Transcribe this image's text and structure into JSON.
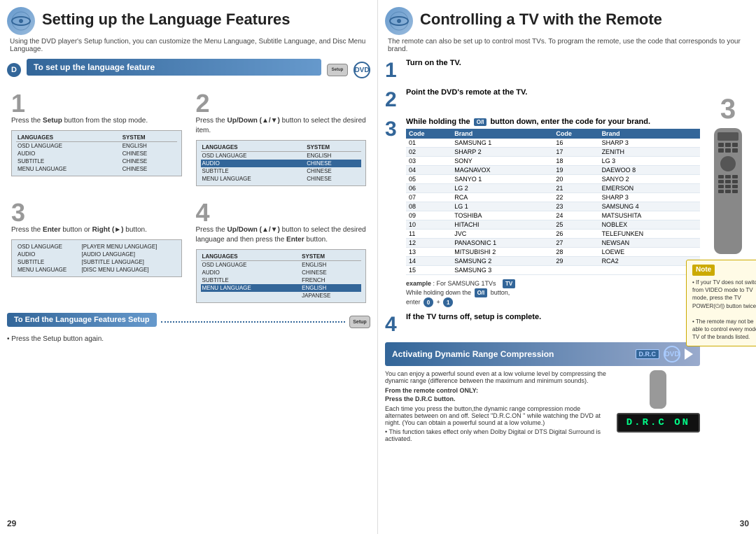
{
  "left": {
    "title": "Setting up the Language Features",
    "subtitle": "Using the DVD player's Setup function, you can customize the Menu Language, Subtitle Language, and Disc Menu Language.",
    "section_bar": "To set up the language feature",
    "dvd_label": "DVD",
    "steps": [
      {
        "num": "1",
        "text": "Press the <b>Setup</b> button from the stop mode.",
        "screen": "languages"
      },
      {
        "num": "2",
        "text": "Press the <b>Up/Down (▲/▼)</b> button to select the desired item.",
        "screen": "languages_selected"
      },
      {
        "num": "3",
        "text": "Press the <b>Enter</b> button or <b>Right (►)</b> button.",
        "screen": "languages_enter"
      },
      {
        "num": "4",
        "text": "Press the <b>Up/Down (▲/▼)</b> button to select the desired language and then press the <b>Enter</b> button.",
        "screen": "languages_final"
      }
    ],
    "end_bar": "To End the Language Features Setup",
    "press_setup": "• Press the Setup button again.",
    "setup_label": "Setup",
    "page_num": "29"
  },
  "right": {
    "title": "Controlling a TV with the Remote",
    "subtitle": "The remote can also be set up to control most TVs. To program the remote, use the code that corresponds to your brand.",
    "steps": [
      {
        "num": "1",
        "text": "Turn on the TV."
      },
      {
        "num": "2",
        "text": "Point the DVD's remote at the TV."
      },
      {
        "num": "3",
        "text": "While holding the <b>O/I</b> button down, enter the code for your brand."
      }
    ],
    "table_headers": [
      "Code",
      "Brand",
      "Code",
      "Brand"
    ],
    "table_rows": [
      [
        "01",
        "SAMSUNG 1",
        "16",
        "SHARP 3"
      ],
      [
        "02",
        "SHARP 2",
        "17",
        "ZENITH"
      ],
      [
        "03",
        "SONY",
        "18",
        "LG 3"
      ],
      [
        "04",
        "MAGNAVOX",
        "19",
        "DAEWOO 8"
      ],
      [
        "05",
        "SANYO 1",
        "20",
        "SANYO 2"
      ],
      [
        "06",
        "LG 2",
        "21",
        "EMERSON"
      ],
      [
        "07",
        "RCA",
        "22",
        "SHARP 3"
      ],
      [
        "08",
        "LG 1",
        "23",
        "SAMSUNG 4"
      ],
      [
        "09",
        "TOSHIBA",
        "24",
        "MATSUSHITA"
      ],
      [
        "10",
        "HITACHI",
        "25",
        "NOBLEX"
      ],
      [
        "11",
        "JVC",
        "26",
        "TELEFUNKEN"
      ],
      [
        "12",
        "PANASONIC 1",
        "27",
        "NEWSAN"
      ],
      [
        "13",
        "MITSUBISHI 2",
        "28",
        "LOEWE"
      ],
      [
        "14",
        "SAMSUNG 2",
        "29",
        "RCA2"
      ],
      [
        "15",
        "SAMSUNG 3",
        "",
        ""
      ]
    ],
    "example_text": "example : For SAMSUNG 1TVs",
    "example_detail": "While holding down the O/I button, enter",
    "step4_text": "If the TV turns off, setup is complete.",
    "drc_title": "Activating Dynamic Range Compression",
    "drc_display": "D.R.C ON",
    "drc_text1": "You can enjoy a powerful sound even at a low volume level by compressing the dynamic range (difference between the maximum and minimum sounds).",
    "from_remote": "From the remote control ONLY:",
    "press_drc": "Press the D.R.C button.",
    "drc_detail1": "Each time you press the button,the dynamic range compression mode alternates between on and off. Select \"D.R.C.ON \" while watching the DVD at night. (You can obtain a powerful sound at a low volume.)",
    "drc_detail2": "• This function takes effect only when Dolby Digital or DTS Digital Surround is activated.",
    "note_title": "Note",
    "note_lines": [
      "• If your TV does not switch from VIDEO mode to TV mode, press the TV POWER(⏻/|) button twice.",
      "• The remote may not be able to control every model TV of the brands listed."
    ],
    "page_num": "30",
    "drc_label": "D.R.C",
    "dvd_label": "DVD"
  }
}
